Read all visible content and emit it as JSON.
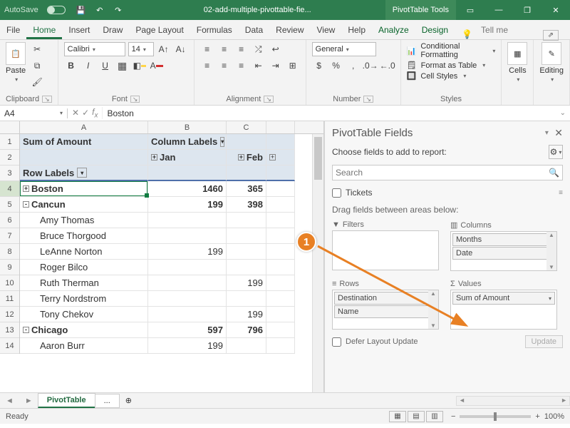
{
  "titlebar": {
    "autosave": "AutoSave",
    "filename": "02-add-multiple-pivottable-fie...",
    "ptt": "PivotTable Tools"
  },
  "tabs": {
    "file": "File",
    "home": "Home",
    "insert": "Insert",
    "draw": "Draw",
    "pagelayout": "Page Layout",
    "formulas": "Formulas",
    "data": "Data",
    "review": "Review",
    "view": "View",
    "help": "Help",
    "analyze": "Analyze",
    "design": "Design",
    "tell": "Tell me"
  },
  "ribbon": {
    "clipboard": {
      "label": "Clipboard",
      "paste": "Paste"
    },
    "font": {
      "label": "Font",
      "name": "Calibri",
      "size": "14"
    },
    "alignment": {
      "label": "Alignment"
    },
    "number": {
      "label": "Number",
      "format": "General"
    },
    "styles": {
      "label": "Styles",
      "cond": "Conditional Formatting",
      "table": "Format as Table",
      "cell": "Cell Styles"
    },
    "cells": {
      "label": "Cells"
    },
    "editing": {
      "label": "Editing"
    }
  },
  "formula": {
    "namebox": "A4",
    "value": "Boston"
  },
  "pivot": {
    "sumOf": "Sum of Amount",
    "colLabels": "Column Labels",
    "rowLabels": "Row Labels",
    "months": [
      "Jan",
      "Feb"
    ],
    "rows": [
      {
        "label": "Boston",
        "level": 0,
        "exp": "+",
        "b": "1460",
        "c": "365"
      },
      {
        "label": "Cancun",
        "level": 0,
        "exp": "-",
        "b": "199",
        "c": "398"
      },
      {
        "label": "Amy Thomas",
        "level": 1
      },
      {
        "label": "Bruce Thorgood",
        "level": 1
      },
      {
        "label": "LeAnne Norton",
        "level": 1,
        "b": "199"
      },
      {
        "label": "Roger Bilco",
        "level": 1
      },
      {
        "label": "Ruth Therman",
        "level": 1,
        "c": "199"
      },
      {
        "label": "Terry Nordstrom",
        "level": 1
      },
      {
        "label": "Tony Chekov",
        "level": 1,
        "c": "199"
      },
      {
        "label": "Chicago",
        "level": 0,
        "exp": "-",
        "b": "597",
        "c": "796"
      },
      {
        "label": "Aaron Burr",
        "level": 1,
        "b": "199"
      }
    ]
  },
  "pane": {
    "title": "PivotTable Fields",
    "choose": "Choose fields to add to report:",
    "search": "Search",
    "field0": "Tickets",
    "drag": "Drag fields between areas below:",
    "filters": "Filters",
    "columns": "Columns",
    "rowsLbl": "Rows",
    "values": "Values",
    "colItems": [
      "Months",
      "Date"
    ],
    "rowItems": [
      "Destination",
      "Name"
    ],
    "valItems": [
      "Sum of Amount"
    ],
    "defer": "Defer Layout Update",
    "update": "Update"
  },
  "sheet": {
    "tab1": "PivotTable",
    "tab2": "..."
  },
  "status": {
    "ready": "Ready",
    "zoom": "100%"
  }
}
